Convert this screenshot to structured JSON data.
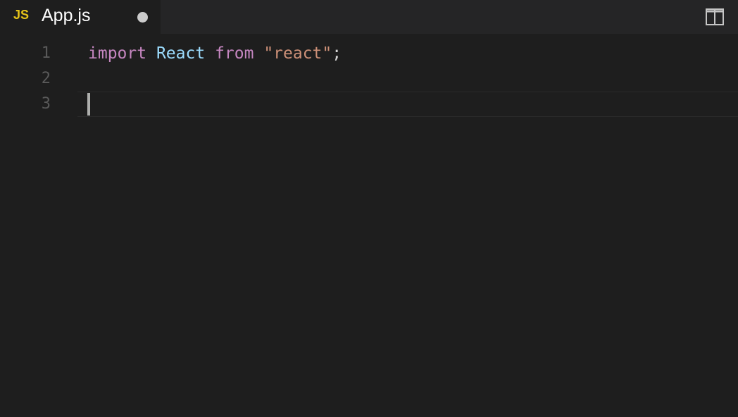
{
  "tab": {
    "language_badge": "JS",
    "title": "App.js",
    "unsaved_indicator": "dirty-dot"
  },
  "toolbar": {
    "split_editor_icon": "split-editor-icon"
  },
  "editor": {
    "line_numbers": [
      "1",
      "2",
      "3"
    ],
    "lines": [
      {
        "tokens": [
          {
            "text": "import",
            "kind": "keyword"
          },
          {
            "text": " ",
            "kind": "space"
          },
          {
            "text": "React",
            "kind": "identifier"
          },
          {
            "text": " ",
            "kind": "space"
          },
          {
            "text": "from",
            "kind": "keyword"
          },
          {
            "text": " ",
            "kind": "space"
          },
          {
            "text": "\"react\"",
            "kind": "string"
          },
          {
            "text": ";",
            "kind": "punctuation"
          }
        ]
      },
      {
        "tokens": []
      },
      {
        "tokens": []
      }
    ],
    "cursor_line": 3
  },
  "colors": {
    "background": "#1e1e1e",
    "tabbar": "#252526",
    "js_badge": "#e6c419",
    "keyword": "#c586c0",
    "identifier": "#9cdcfe",
    "string": "#ce9178",
    "line_number": "#5a5a5a"
  }
}
